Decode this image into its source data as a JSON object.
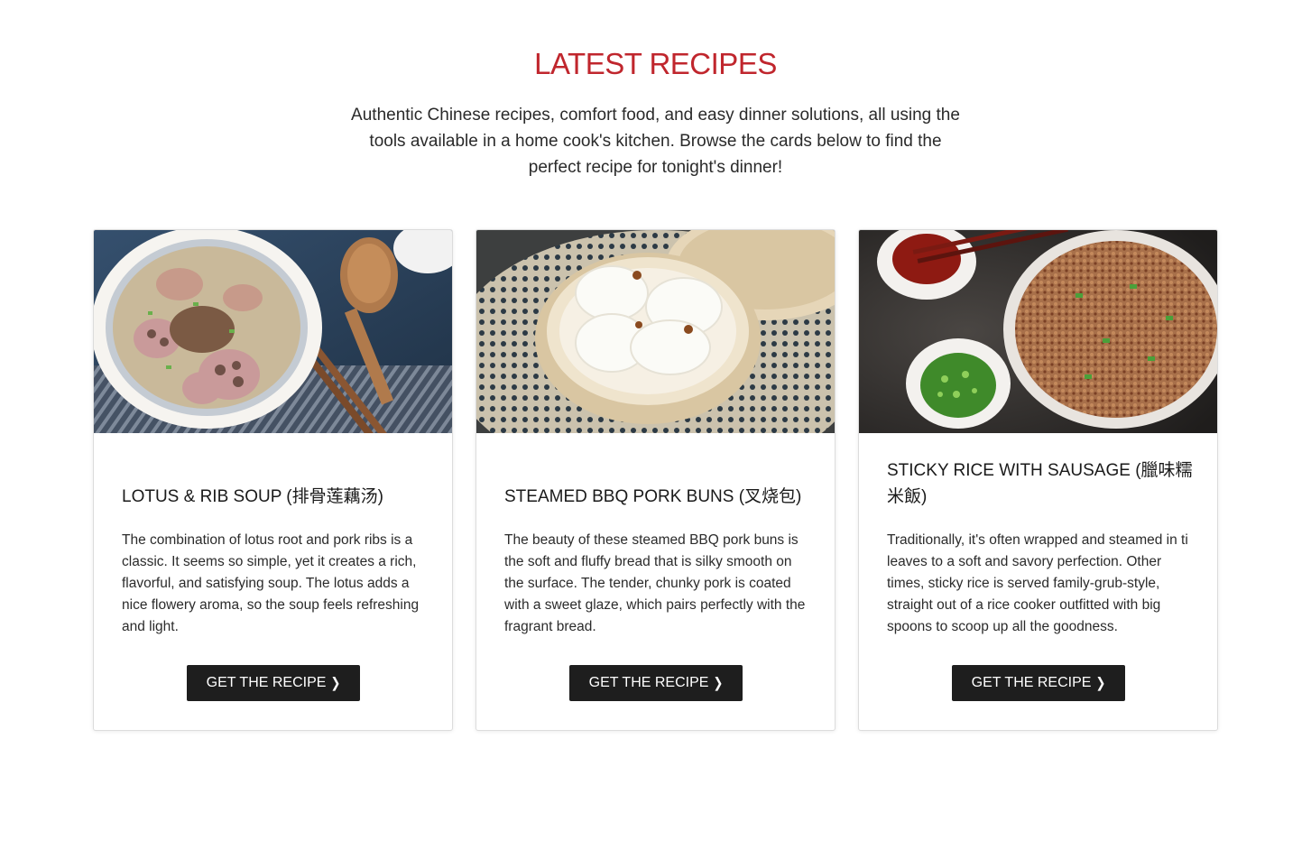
{
  "section": {
    "title": "LATEST RECIPES",
    "intro": "Authentic Chinese recipes, comfort food, and easy dinner solutions, all using the tools available in a home cook's kitchen. Browse the cards below to find the perfect recipe for tonight's dinner!"
  },
  "cards": [
    {
      "title": "LOTUS & RIB SOUP (排骨莲藕汤)",
      "description": "The combination of lotus root and pork ribs is a classic. It seems so simple, yet it creates a rich, flavorful, and satisfying soup. The lotus adds a nice flowery aroma, so the soup feels refreshing and light.",
      "button_label": "GET THE RECIPE",
      "button_icon": "chevron-right-icon"
    },
    {
      "title": "STEAMED BBQ PORK BUNS (叉烧包)",
      "description": "The beauty of these steamed BBQ pork buns is the soft and fluffy bread that is silky smooth on the surface. The tender, chunky pork is coated with a sweet glaze, which pairs perfectly with the fragrant bread.",
      "button_label": "GET THE RECIPE",
      "button_icon": "chevron-right-icon"
    },
    {
      "title": "STICKY RICE WITH SAUSAGE (臘味糯米飯)",
      "description": "Traditionally, it's often wrapped and steamed in ti leaves to a soft and savory perfection. Other times, sticky rice is served family-grub-style, straight out of a rice cooker outfitted with big spoons to scoop up all the goodness.",
      "button_label": "GET THE RECIPE",
      "button_icon": "chevron-right-icon"
    }
  ],
  "colors": {
    "title_red": "#c0262d",
    "button_dark": "#1e1e1e"
  }
}
